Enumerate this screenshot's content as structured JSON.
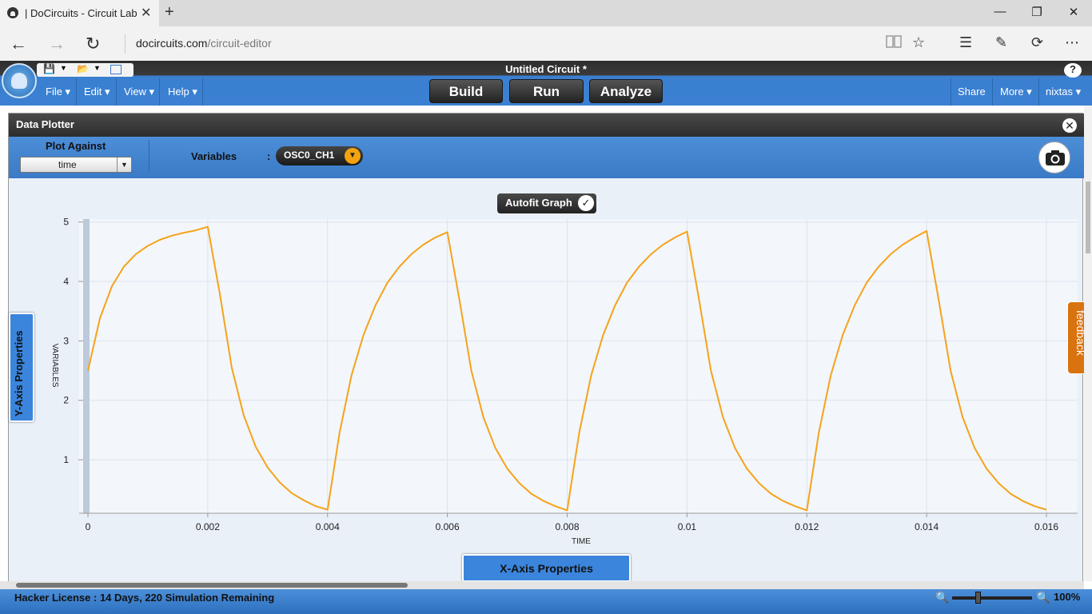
{
  "browser": {
    "tab_title": "| DoCircuits - Circuit Lab",
    "tab_close": "✕",
    "new_tab": "+",
    "minimize": "—",
    "restore": "❐",
    "close": "✕",
    "back": "←",
    "forward": "→",
    "refresh": "↻",
    "url_host": "docircuits.com",
    "url_path": "/circuit-editor",
    "icons": [
      "reading-view-icon",
      "favorite-star-icon",
      "hub-icon",
      "web-note-icon",
      "share-icon",
      "more-icon"
    ]
  },
  "app": {
    "title": "Untitled Circuit *",
    "menus": [
      "File ▾",
      "Edit ▾",
      "View ▾",
      "Help ▾"
    ],
    "modes": [
      "Build",
      "Run",
      "Analyze"
    ],
    "right_menus": [
      "Share",
      "More ▾",
      "nixtas ▾"
    ],
    "help": "?"
  },
  "plotter": {
    "title": "Data Plotter",
    "close": "✕",
    "plot_against_label": "Plot Against",
    "plot_against_value": "time",
    "variables_label": "Variables",
    "colon": ":",
    "variable_chip": "OSC0_CH1",
    "autofit_label": "Autofit Graph",
    "autofit_checked": true,
    "y_axis_tab": "Y-Axis Properties",
    "x_axis_tab": "X-Axis Properties"
  },
  "feedback": "feedback",
  "status": {
    "license": "Hacker License : 14 Days, 220 Simulation Remaining",
    "zoom": "100%"
  },
  "colors": {
    "accent_blue": "#3b80d2",
    "trace": "#f5a31a",
    "feedback": "#d9730f"
  },
  "chart_data": {
    "type": "line",
    "xlabel": "TIME",
    "ylabel": "VARIABLES",
    "x_ticks": [
      "0",
      "0.002",
      "0.004",
      "0.006",
      "0.008",
      "0.01",
      "0.012",
      "0.014",
      "0.016"
    ],
    "y_ticks": [
      "1",
      "2",
      "3",
      "4",
      "5"
    ],
    "xlim": [
      0,
      0.016
    ],
    "ylim": [
      0.1,
      5.05
    ],
    "grid": true,
    "series": [
      {
        "color": "#f5a31a",
        "x": [
          0,
          0.0002,
          0.0004,
          0.0006,
          0.0008,
          0.001,
          0.0012,
          0.0014,
          0.0016,
          0.0018,
          0.002,
          0.0022,
          0.0024,
          0.0026,
          0.0028,
          0.003,
          0.0032,
          0.0034,
          0.0036,
          0.0038,
          0.004,
          0.0042,
          0.0044,
          0.0046,
          0.0048,
          0.005,
          0.0052,
          0.0054,
          0.0056,
          0.0058,
          0.006,
          0.0062,
          0.0064,
          0.0066,
          0.0068,
          0.007,
          0.0072,
          0.0074,
          0.0076,
          0.0078,
          0.008,
          0.0082,
          0.0084,
          0.0086,
          0.0088,
          0.009,
          0.0092,
          0.0094,
          0.0096,
          0.0098,
          0.01,
          0.0102,
          0.0104,
          0.0106,
          0.0108,
          0.011,
          0.0112,
          0.0114,
          0.0116,
          0.0118,
          0.012,
          0.0122,
          0.0124,
          0.0126,
          0.0128,
          0.013,
          0.0132,
          0.0134,
          0.0136,
          0.0138,
          0.014,
          0.0142,
          0.0144,
          0.0146,
          0.0148,
          0.015,
          0.0152,
          0.0154,
          0.0156,
          0.0158,
          0.016
        ],
        "values": [
          2.5,
          3.38,
          3.92,
          4.25,
          4.46,
          4.6,
          4.7,
          4.77,
          4.82,
          4.86,
          4.92,
          3.8,
          2.55,
          1.75,
          1.22,
          0.87,
          0.62,
          0.44,
          0.32,
          0.22,
          0.16,
          1.45,
          2.42,
          3.1,
          3.6,
          3.98,
          4.25,
          4.46,
          4.62,
          4.74,
          4.83,
          3.7,
          2.5,
          1.72,
          1.2,
          0.85,
          0.61,
          0.43,
          0.31,
          0.22,
          0.15,
          1.45,
          2.42,
          3.1,
          3.6,
          3.98,
          4.25,
          4.46,
          4.62,
          4.74,
          4.84,
          3.7,
          2.5,
          1.72,
          1.2,
          0.85,
          0.61,
          0.43,
          0.31,
          0.22,
          0.15,
          1.45,
          2.42,
          3.1,
          3.6,
          3.98,
          4.25,
          4.46,
          4.62,
          4.74,
          4.85,
          3.7,
          2.5,
          1.72,
          1.2,
          0.85,
          0.61,
          0.43,
          0.31,
          0.22,
          0.16
        ]
      }
    ]
  }
}
